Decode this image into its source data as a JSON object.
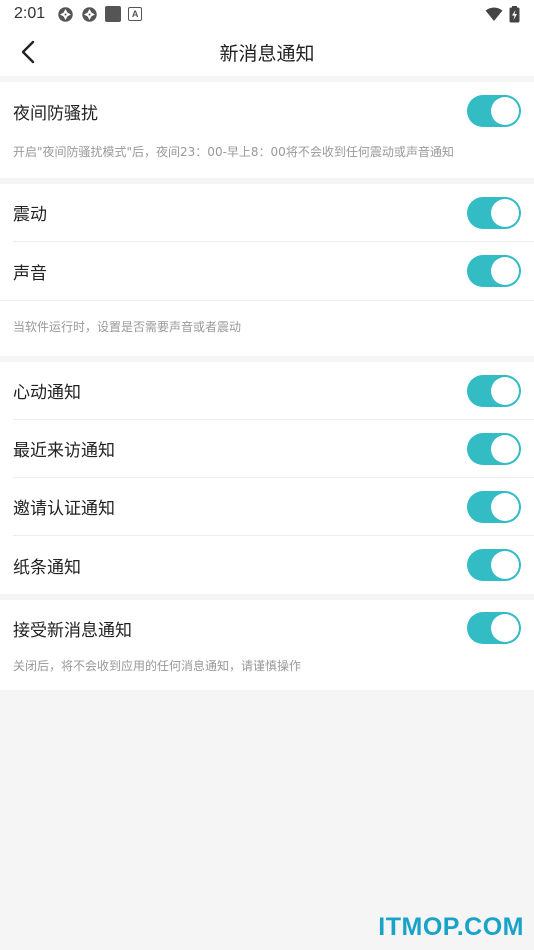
{
  "status_bar": {
    "time": "2:01",
    "left_icons": [
      "aperture-icon",
      "aperture-icon",
      "square-icon",
      "font-icon"
    ],
    "right_icons": [
      "wifi-icon",
      "battery-charging-icon"
    ]
  },
  "header": {
    "title": "新消息通知",
    "back_icon": "chevron-left-icon"
  },
  "sections": {
    "night": {
      "label": "夜间防骚扰",
      "enabled": true,
      "hint": "开启\"夜间防骚扰模式\"后，夜间23：00-早上8：00将不会收到任何震动或声音通知"
    },
    "vibrate": {
      "label": "震动",
      "enabled": true
    },
    "sound": {
      "label": "声音",
      "enabled": true
    },
    "vibrate_sound_hint": "当软件运行时，设置是否需要声音或者震动",
    "heartbeat": {
      "label": "心动通知",
      "enabled": true
    },
    "recent_visitors": {
      "label": "最近来访通知",
      "enabled": true
    },
    "invite_verify": {
      "label": "邀请认证通知",
      "enabled": true
    },
    "note": {
      "label": "纸条通知",
      "enabled": true
    },
    "receive_new": {
      "label": "接受新消息通知",
      "enabled": true,
      "hint": "关闭后，将不会收到应用的任何消息通知，请谨慎操作"
    }
  },
  "colors": {
    "toggle_on": "#33bcc4",
    "background": "#f5f5f5",
    "watermark": "#1aa3c9"
  },
  "watermark": "ITMOP.COM"
}
